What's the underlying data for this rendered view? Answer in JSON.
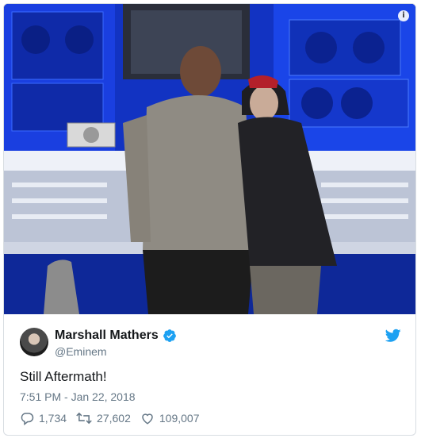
{
  "tweet": {
    "author_name": "Marshall Mathers",
    "handle": "@Eminem",
    "text": "Still Aftermath!",
    "timestamp": "7:51 PM - Jan 22, 2018",
    "verified": true,
    "media": {
      "description_icon": "info-icon",
      "info_glyph": "i"
    },
    "stats": {
      "replies": "1,734",
      "retweets": "27,602",
      "likes": "109,007"
    },
    "icons": {
      "reply": "reply-icon",
      "retweet": "retweet-icon",
      "like": "heart-icon",
      "brand": "twitter-bird-icon",
      "verified": "verified-badge-icon"
    },
    "colors": {
      "brand": "#1da1f2",
      "text": "#14171a",
      "secondary": "#657786"
    }
  }
}
